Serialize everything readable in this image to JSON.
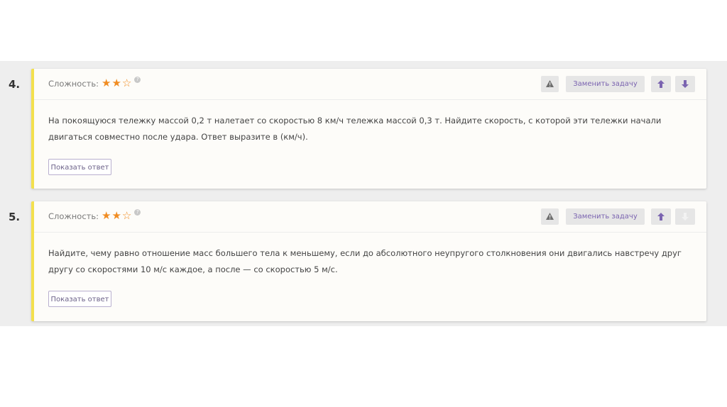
{
  "colors": {
    "accent": "#7b64b0",
    "star": "#f08c22",
    "card_border": "#f3e04e"
  },
  "tasks": [
    {
      "number": "4.",
      "difficulty_label": "Сложность:",
      "difficulty_stars": 2,
      "difficulty_max": 3,
      "help_icon": "question-icon",
      "replace_label": "Заменить задачу",
      "move_up_enabled": true,
      "move_down_enabled": true,
      "text": "На покоящуюся тележку массой 0,2 т налетает со скоростью 8 км/ч тележка массой 0,3 т. Найдите скорость, с которой эти тележки начали двигаться совместно после удара. Ответ выразите в (км/ч).",
      "show_answer_label": "Показать ответ"
    },
    {
      "number": "5.",
      "difficulty_label": "Сложность:",
      "difficulty_stars": 2,
      "difficulty_max": 3,
      "help_icon": "question-icon",
      "replace_label": "Заменить задачу",
      "move_up_enabled": true,
      "move_down_enabled": false,
      "text": "Найдите, чему равно отношение масс большего тела к меньшему, если до абсолютного неупругого столкновения они двигались навстречу друг другу со скоростями 10 м/с каждое, а после — со скоростью 5 м/с.",
      "show_answer_label": "Показать ответ"
    }
  ]
}
